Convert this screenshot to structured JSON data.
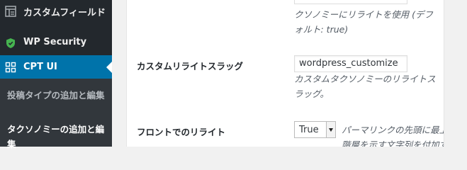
{
  "sidebar": {
    "items": [
      {
        "label": "カスタムフィールド",
        "icon": "custom-fields-icon"
      },
      {
        "label": "WP Security",
        "icon": "shield-icon"
      },
      {
        "label": "CPT UI",
        "icon": "cpt-ui-icon",
        "active": true
      }
    ],
    "submenu": [
      {
        "label": "投稿タイプの追加と編集"
      },
      {
        "label": "タクソノミーの追加と編集",
        "current": true
      }
    ]
  },
  "form": {
    "top_row": {
      "help": "クソノミーにリライトを使用 (デフォルト: true)"
    },
    "custom_rewrite_slug": {
      "label": "カスタムリライトスラッグ",
      "value": "wordpress_customize",
      "help": "カスタムタクソノミーのリライトスラッグ。"
    },
    "front_rewrite": {
      "label": "フロントでのリライト",
      "selected": "True",
      "help": "パーマリンクの先頭に最上位階層を示す文字列を付加す"
    }
  },
  "colors": {
    "sidebar_bg": "#23282d",
    "submenu_bg": "#32373c",
    "active_bg": "#0073aa",
    "shield_green": "#46b450"
  }
}
